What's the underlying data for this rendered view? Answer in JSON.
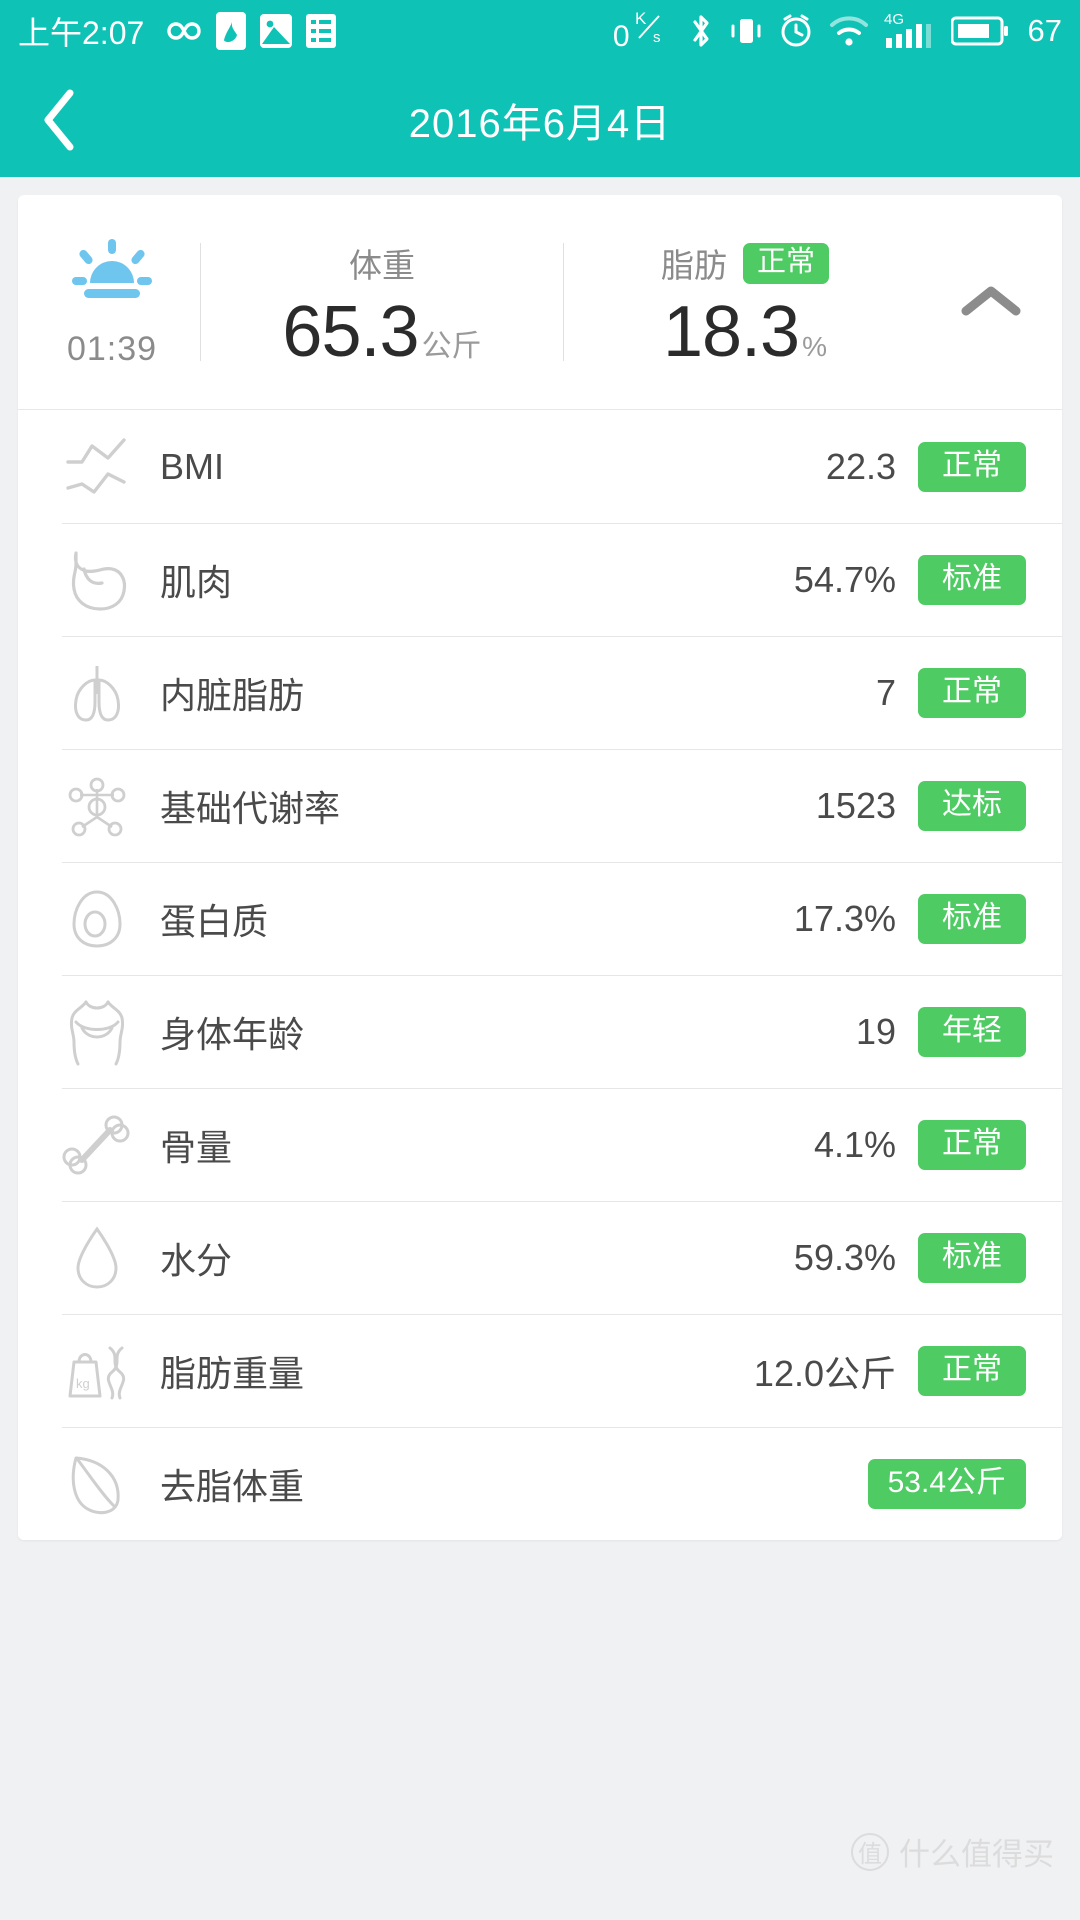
{
  "statusbar": {
    "clock": "上午2:07",
    "netspeed_value": "0",
    "netspeed_unit_top": "K",
    "netspeed_unit_bottom": "s",
    "network_type": "4G",
    "battery_percent": "67",
    "icons": [
      "infinity-icon",
      "app-icon",
      "image-icon",
      "list-icon",
      "bluetooth-icon",
      "vibrate-icon",
      "alarm-icon",
      "wifi-icon",
      "signal-icon",
      "battery-icon"
    ]
  },
  "header": {
    "title": "2016年6月4日",
    "back_label": "返回"
  },
  "summary": {
    "time": "01:39",
    "period_icon": "sunrise-icon",
    "weight": {
      "label": "体重",
      "value": "65.3",
      "unit": "公斤"
    },
    "fat": {
      "label": "脂肪",
      "badge": "正常",
      "value": "18.3",
      "unit": "%"
    },
    "collapse_icon": "chevron-up-icon"
  },
  "metrics": [
    {
      "icon": "trend-line-icon",
      "label": "BMI",
      "value": "22.3",
      "badge": "正常",
      "badge_only": false
    },
    {
      "icon": "muscle-arm-icon",
      "label": "肌肉",
      "value": "54.7%",
      "badge": "标准",
      "badge_only": false
    },
    {
      "icon": "lungs-icon",
      "label": "内脏脂肪",
      "value": "7",
      "badge": "正常",
      "badge_only": false
    },
    {
      "icon": "molecule-icon",
      "label": "基础代谢率",
      "value": "1523",
      "badge": "达标",
      "badge_only": false
    },
    {
      "icon": "protein-egg-icon",
      "label": "蛋白质",
      "value": "17.3%",
      "badge": "标准",
      "badge_only": false
    },
    {
      "icon": "body-torso-icon",
      "label": "身体年龄",
      "value": "19",
      "badge": "年轻",
      "badge_only": false
    },
    {
      "icon": "bone-icon",
      "label": "骨量",
      "value": "4.1%",
      "badge": "正常",
      "badge_only": false
    },
    {
      "icon": "water-drop-icon",
      "label": "水分",
      "value": "59.3%",
      "badge": "标准",
      "badge_only": false
    },
    {
      "icon": "weight-bag-icon",
      "label": "脂肪重量",
      "value": "12.0公斤",
      "badge": "正常",
      "badge_only": false
    },
    {
      "icon": "leaf-icon",
      "label": "去脂体重",
      "value": "",
      "badge": "53.4公斤",
      "badge_only": true
    }
  ],
  "watermark": {
    "mark": "值",
    "text": "什么值得买"
  },
  "colors": {
    "brand_teal": "#0ec3b5",
    "badge_green": "#4ecb62",
    "sunrise_blue": "#6ec6ef",
    "page_bg": "#f0f1f3",
    "text_dark": "#4a4a4a",
    "text_muted": "#8b8b8b"
  }
}
